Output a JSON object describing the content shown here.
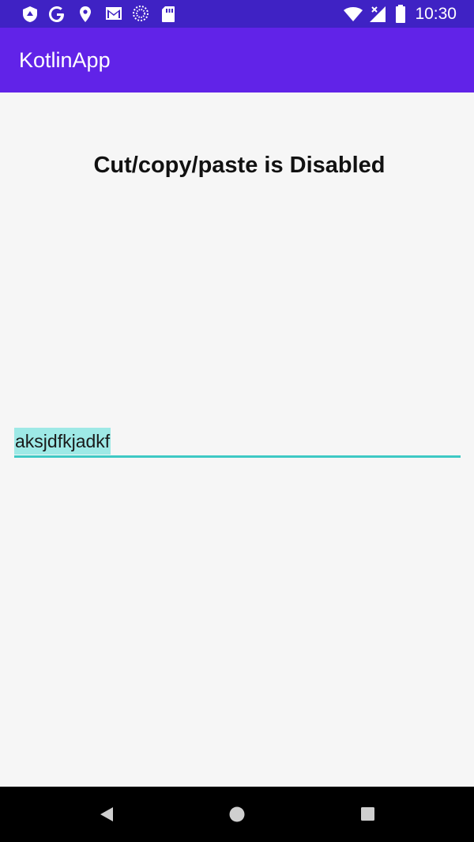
{
  "status_bar": {
    "time": "10:30",
    "icons_left": [
      "shield-icon",
      "google-icon",
      "location-icon",
      "gmail-icon",
      "loading-icon",
      "sdcard-icon"
    ],
    "icons_right": [
      "wifi-icon",
      "signal-icon",
      "battery-icon"
    ]
  },
  "app_bar": {
    "title": "KotlinApp",
    "color": "#6123e8"
  },
  "main": {
    "heading": "Cut/copy/paste is Disabled",
    "edit_text": {
      "value": "aksjdfkjadkf",
      "selected": true,
      "accent_color": "#3ec9c4"
    }
  },
  "nav_bar": {
    "buttons": [
      "back-icon",
      "home-icon",
      "recents-icon"
    ]
  }
}
